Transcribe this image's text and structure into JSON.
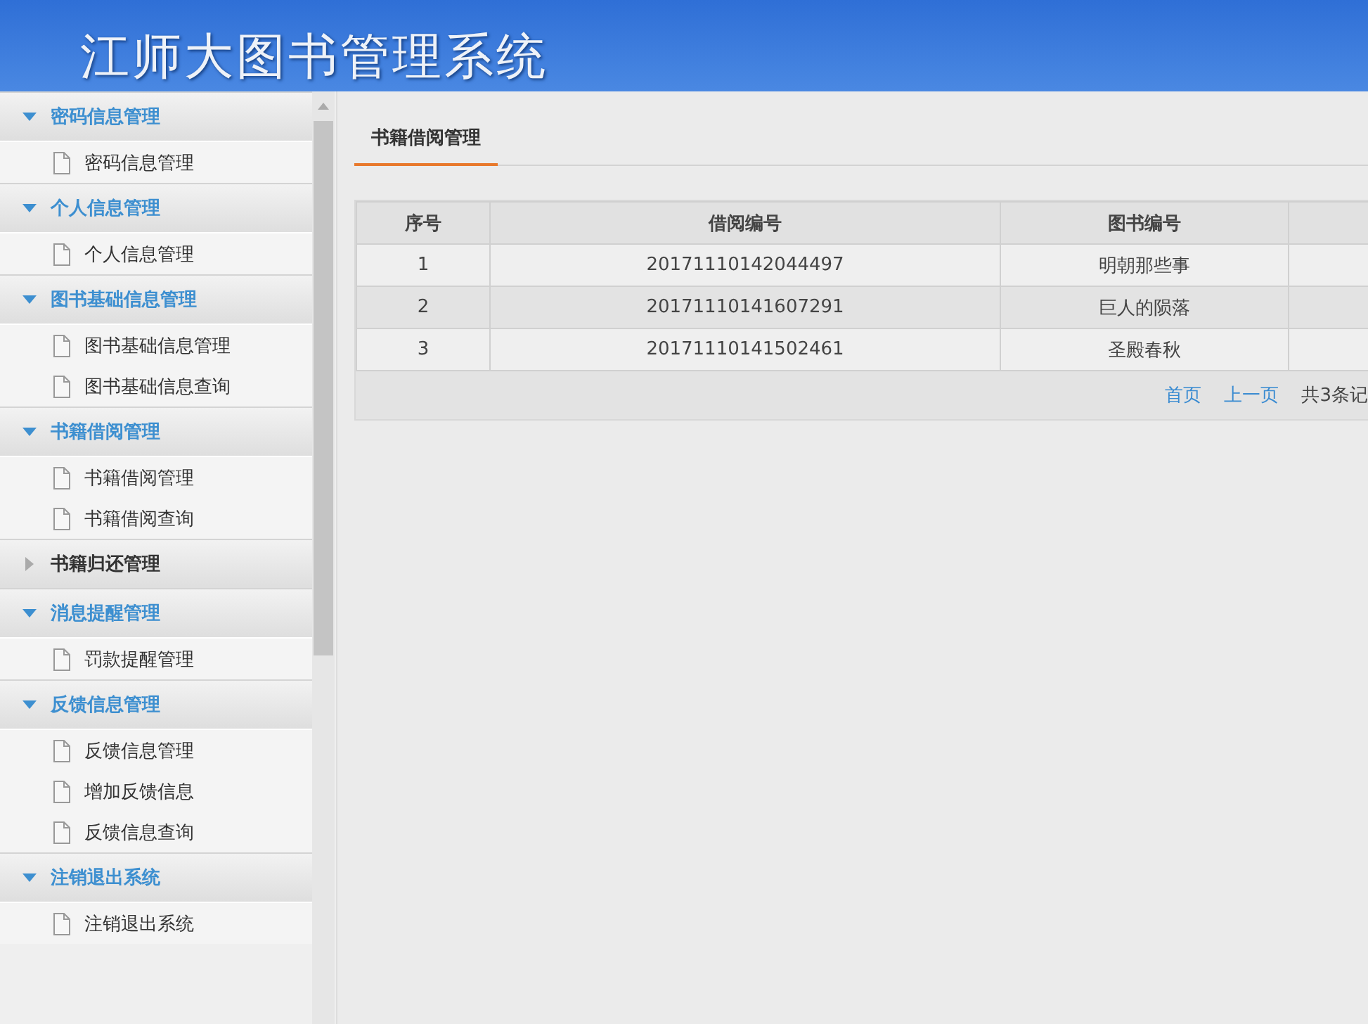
{
  "header": {
    "title": "江师大图书管理系统"
  },
  "sidebar": {
    "groups": [
      {
        "label": "密码信息管理",
        "expanded": true,
        "items": [
          "密码信息管理"
        ]
      },
      {
        "label": "个人信息管理",
        "expanded": true,
        "items": [
          "个人信息管理"
        ]
      },
      {
        "label": "图书基础信息管理",
        "expanded": true,
        "items": [
          "图书基础信息管理",
          "图书基础信息查询"
        ]
      },
      {
        "label": "书籍借阅管理",
        "expanded": true,
        "items": [
          "书籍借阅管理",
          "书籍借阅查询"
        ]
      },
      {
        "label": "书籍归还管理",
        "expanded": false
      },
      {
        "label": "消息提醒管理",
        "expanded": true,
        "items": [
          "罚款提醒管理"
        ]
      },
      {
        "label": "反馈信息管理",
        "expanded": true,
        "items": [
          "反馈信息管理",
          "增加反馈信息",
          "反馈信息查询"
        ]
      },
      {
        "label": "注销退出系统",
        "expanded": true,
        "items": [
          "注销退出系统"
        ]
      }
    ]
  },
  "tabs": [
    {
      "label": "书籍借阅管理",
      "selected": true
    }
  ],
  "table": {
    "columns": [
      "序号",
      "借阅编号",
      "图书编号"
    ],
    "rows": [
      [
        "1",
        "20171110142044497",
        "明朝那些事"
      ],
      [
        "2",
        "20171110141607291",
        "巨人的陨落"
      ],
      [
        "3",
        "20171110141502461",
        "圣殿春秋"
      ]
    ]
  },
  "pager": {
    "links": [
      "首页",
      "上一页"
    ],
    "summary": "共3条记"
  }
}
